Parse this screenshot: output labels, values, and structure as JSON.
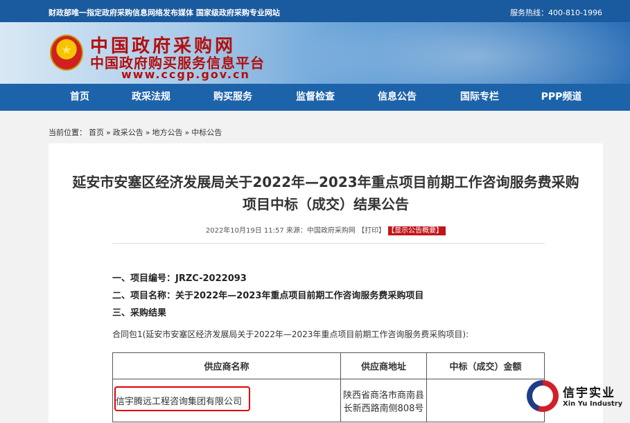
{
  "topbar": {
    "left_text": "财政部唯一指定政府采购信息网络发布媒体 国家级政府采购专业网站",
    "hotline": "服务热线：400-810-1996"
  },
  "header": {
    "site_name": "中国政府采购网",
    "platform_name": "中国政府购买服务信息平台",
    "site_url": "www.ccgp.gov.cn"
  },
  "nav": {
    "items": [
      {
        "label": "首页"
      },
      {
        "label": "政采法规"
      },
      {
        "label": "购买服务"
      },
      {
        "label": "监督检查"
      },
      {
        "label": "信息公告"
      },
      {
        "label": "国际专栏"
      },
      {
        "label": "PPP频道"
      }
    ]
  },
  "breadcrumb": {
    "prefix": "当前位置：",
    "items": [
      "首页",
      "政采公告",
      "地方公告",
      "中标公告"
    ],
    "separator": "»"
  },
  "article": {
    "title_line1": "延安市安塞区经济发展局关于2022年—2023年重点项目前期工作咨询服务费采购",
    "title_line2": "项目中标（成交）结果公告",
    "meta": "2022年10月19日 11:57 来源：中国政府采购网 【打印】",
    "meta_badge": "【显示公告概要】",
    "lines": [
      "一、项目编号：JRZC-2022093",
      "二、项目名称：关于2022年—2023年重点项目前期工作咨询服务费采购项目",
      "三、采购结果"
    ],
    "contract_package": "合同包1(延安市安塞区经济发展局关于2022年—2023年重点项目前期工作咨询服务费采购项目):",
    "table": {
      "headers": [
        "供应商名称",
        "供应商地址",
        "中标（成交）金额"
      ],
      "rows": [
        {
          "supplier": "信宇腾远工程咨询集团有限公司",
          "address_line1": "陕西省商洛市商南县",
          "address_line2": "长新西路南侧808号",
          "amount": ""
        }
      ]
    }
  },
  "watermark": {
    "name_cn": "信宇实业",
    "name_en": "Xin Yu Industry"
  },
  "colors": {
    "topbar": "#1a5a9e",
    "nav": "#1d63aa",
    "logo_red": "#b30f0f",
    "highlight_red": "#e00000"
  }
}
